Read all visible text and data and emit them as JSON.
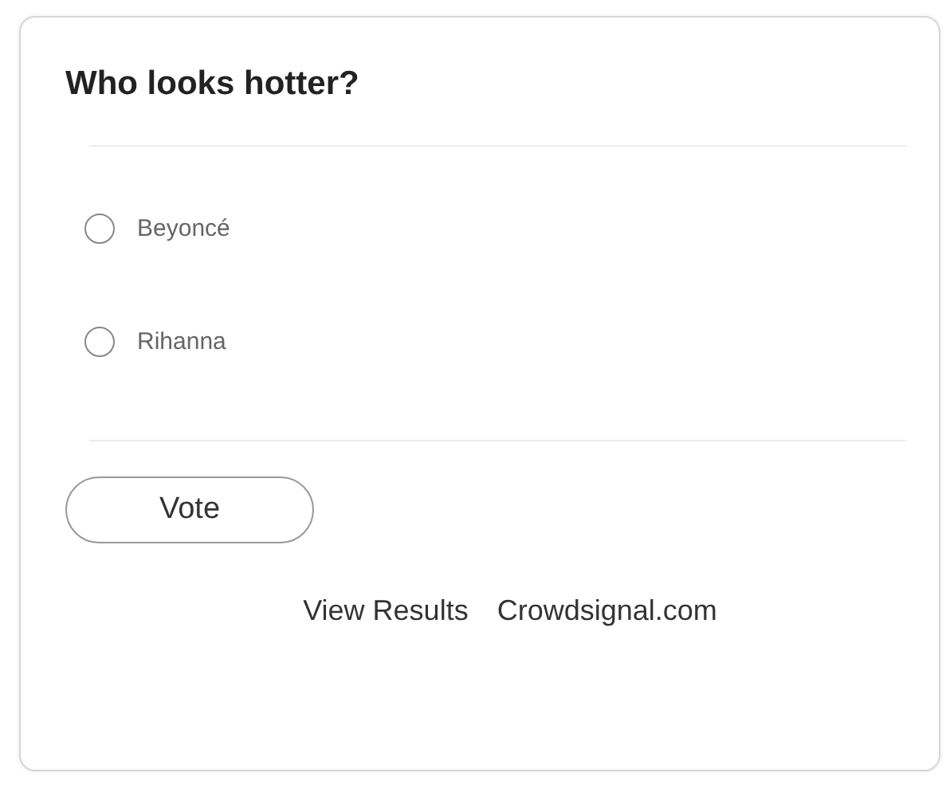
{
  "poll": {
    "question": "Who looks hotter?",
    "options": [
      {
        "label": "Beyoncé",
        "selected": false
      },
      {
        "label": "Rihanna",
        "selected": false
      }
    ],
    "vote_button": "Vote",
    "links": [
      "View Results",
      "Crowdsignal.com"
    ]
  }
}
